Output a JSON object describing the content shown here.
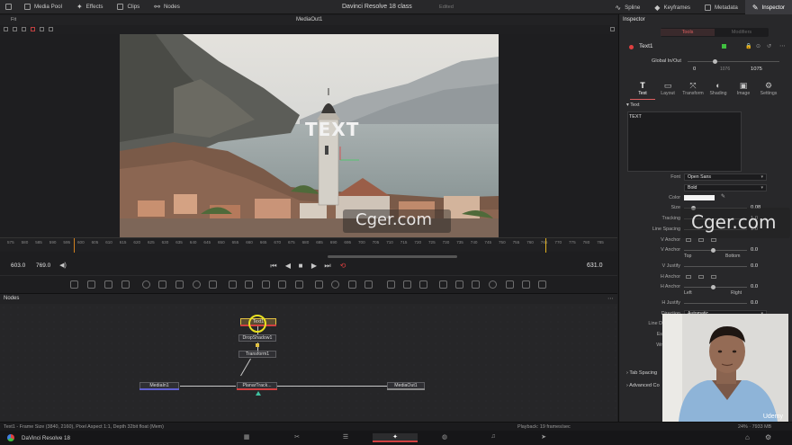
{
  "topbar": {
    "left_items": [
      {
        "label": "Media Pool",
        "icon": "media-pool-icon"
      },
      {
        "label": "Effects",
        "icon": "effects-icon"
      },
      {
        "label": "Clips",
        "icon": "clips-icon"
      },
      {
        "label": "Nodes",
        "icon": "nodes-icon"
      }
    ],
    "project_title": "Davinci Resolve 18 class",
    "status": "Edited",
    "right_items": [
      {
        "label": "Spline",
        "icon": "spline-icon"
      },
      {
        "label": "Keyframes",
        "icon": "keyframes-icon"
      },
      {
        "label": "Metadata",
        "icon": "metadata-icon"
      },
      {
        "label": "Inspector",
        "icon": "inspector-icon"
      }
    ]
  },
  "viewer": {
    "title": "MediaOut1",
    "fit": "Fit",
    "overlay_text": "TEXT",
    "timecode_left": "603.0",
    "timecode_mid": "769.0",
    "current_frame": "631.0",
    "ruler_labels": [
      "575",
      "580",
      "585",
      "590",
      "595",
      "600",
      "605",
      "610",
      "615",
      "620",
      "625",
      "630",
      "635",
      "640",
      "645",
      "650",
      "655",
      "660",
      "665",
      "670",
      "675",
      "680",
      "685",
      "690",
      "695",
      "700",
      "705",
      "710",
      "715",
      "720",
      "725",
      "730",
      "735",
      "740",
      "745",
      "750",
      "755",
      "760",
      "765",
      "770",
      "775",
      "780",
      "785"
    ]
  },
  "watermark": {
    "text": "Cger.com"
  },
  "nodes": {
    "title": "Nodes",
    "items": [
      "Text1",
      "DropShadow1",
      "Transform1",
      "MediaIn1",
      "PlanarTrack...",
      "MediaOut1"
    ]
  },
  "statusbar": {
    "left": "Text1 - Frame Size (3840, 2160), Pixel Aspect 1:1, Depth 32bit float (Mem)",
    "playback": "Playback: 19 frames/sec",
    "memory": "24% · 7933 MB"
  },
  "pagebar": {
    "app_name": "DaVinci Resolve 18",
    "pages": [
      "media",
      "cut",
      "edit",
      "fusion",
      "color",
      "fairlight",
      "deliver"
    ],
    "active": "fusion"
  },
  "inspector": {
    "title": "Inspector",
    "toggle": {
      "tools": "Tools",
      "modifiers": "Modifiers"
    },
    "node_name": "Text1",
    "global_in_out": "Global In/Out",
    "global_start": "0",
    "global_mid": "1076",
    "global_end": "1075",
    "tabs": [
      {
        "label": "Text",
        "icon": "text-tab-icon",
        "glyph": "T"
      },
      {
        "label": "Layout",
        "icon": "layout-tab-icon",
        "glyph": "▭"
      },
      {
        "label": "Transform",
        "icon": "transform-tab-icon",
        "glyph": "⤧"
      },
      {
        "label": "Shading",
        "icon": "shading-tab-icon",
        "glyph": "◐"
      },
      {
        "label": "Image",
        "icon": "image-tab-icon",
        "glyph": "▣"
      },
      {
        "label": "Settings",
        "icon": "settings-tab-icon",
        "glyph": "⚙"
      }
    ],
    "section_text": "Text",
    "text_value": "TEXT",
    "font_label": "Font",
    "font_value": "Open Sans",
    "style_value": "Bold",
    "color_label": "Color",
    "size_label": "Size",
    "size_value": "0.08",
    "tracking_label": "Tracking",
    "tracking_value": "1.0",
    "line_spacing_label": "Line Spacing",
    "line_spacing_value": "1.0",
    "vanchor_label": "V Anchor",
    "vanchor2_label": "V Anchor",
    "vanchor_value": "0.0",
    "top_label": "Top",
    "bottom_label": "Bottom",
    "vjustify_label": "V Justify",
    "vjustify_value": "0.0",
    "hanchor_label": "H Anchor",
    "hanchor2_label": "H Anchor",
    "hanchor_value": "0.0",
    "left_label": "Left",
    "right_label": "Right",
    "hjustify_label": "H Justify",
    "hjustify_value": "0.0",
    "direction_label": "Direction",
    "direction_value": "Automatic",
    "line_dir_label": "Line D",
    "partial_label_1": "Es",
    "partial_label_2": "Wr",
    "tab_spacing": "Tab Spacing",
    "advanced": "Advanced Co"
  },
  "colors": {
    "accent_red": "#e04040",
    "playhead": "#e0b020",
    "background": "#1e1e20"
  }
}
